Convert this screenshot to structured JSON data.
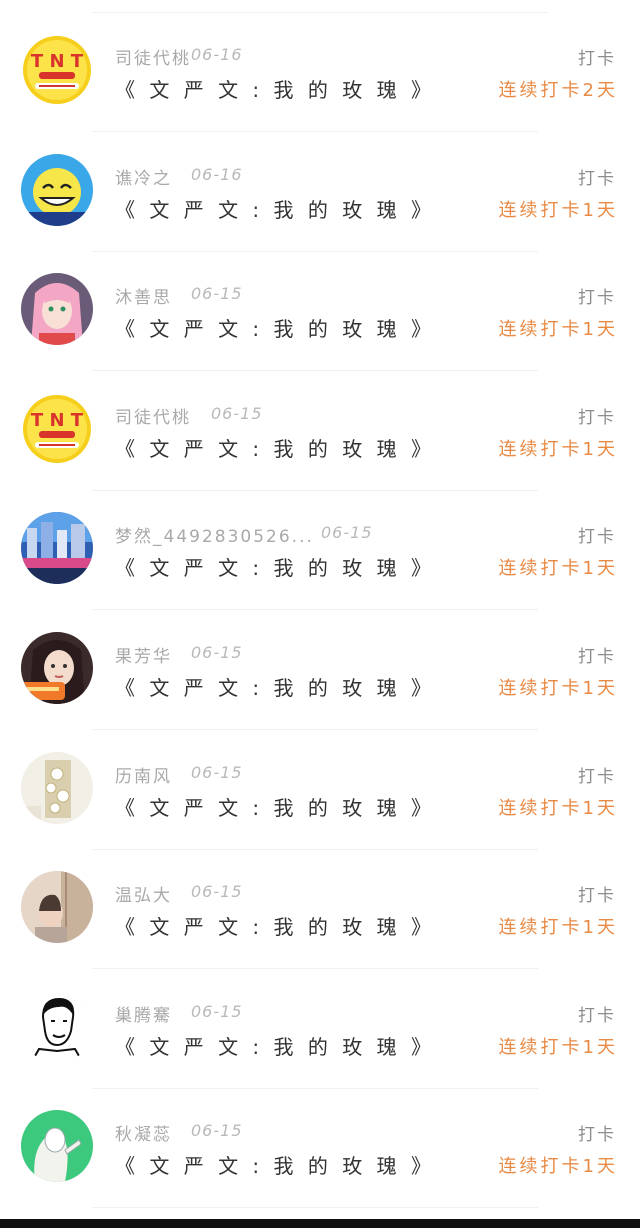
{
  "colors": {
    "name": "#a9a9a9",
    "title": "#333333",
    "action": "#8c8c8c",
    "streak": "#e88a45",
    "divider": "#f0f0f0"
  },
  "records": [
    {
      "name": "司徒代桃",
      "date": "06-16",
      "title": "《 文 严 文 : 我 的 玫 瑰 》",
      "action": "打卡",
      "streak": "连续打卡2天",
      "avatar": "tnt-logo-avatar"
    },
    {
      "name": "谯冷之",
      "date": "06-16",
      "title": "《 文 严 文 : 我 的 玫 瑰 》",
      "action": "打卡",
      "streak": "连续打卡1天",
      "avatar": "yellow-smiley-avatar"
    },
    {
      "name": "沐善思",
      "date": "06-15",
      "title": "《 文 严 文 : 我 的 玫 瑰 》",
      "action": "打卡",
      "streak": "连续打卡1天",
      "avatar": "anime-pink-hair-avatar"
    },
    {
      "name": "司徒代桃",
      "date": "06-15",
      "title": "《 文 严 文 : 我 的 玫 瑰 》",
      "action": "打卡",
      "streak": "连续打卡1天",
      "avatar": "tnt-logo-avatar"
    },
    {
      "name": "梦然_4492830526...",
      "date": "06-15",
      "title": "《 文 严 文 : 我 的 玫 瑰 》",
      "action": "打卡",
      "streak": "连续打卡1天",
      "avatar": "city-skyline-avatar"
    },
    {
      "name": "果芳华",
      "date": "06-15",
      "title": "《 文 严 文 : 我 的 玫 瑰 》",
      "action": "打卡",
      "streak": "连续打卡1天",
      "avatar": "girl-portrait-avatar"
    },
    {
      "name": "历南风",
      "date": "06-15",
      "title": "《 文 严 文 : 我 的 玫 瑰 》",
      "action": "打卡",
      "streak": "连续打卡1天",
      "avatar": "crystal-decor-avatar"
    },
    {
      "name": "温弘大",
      "date": "06-15",
      "title": "《 文 严 文 : 我 的 玫 瑰 》",
      "action": "打卡",
      "streak": "连续打卡1天",
      "avatar": "door-photo-avatar"
    },
    {
      "name": "巢腾騫",
      "date": "06-15",
      "title": "《 文 严 文 : 我 的 玫 瑰 》",
      "action": "打卡",
      "streak": "连续打卡1天",
      "avatar": "man-sketch-avatar"
    },
    {
      "name": "秋凝蕊",
      "date": "06-15",
      "title": "《 文 严 文 : 我 的 玫 瑰 》",
      "action": "打卡",
      "streak": "连续打卡1天",
      "avatar": "green-illustration-avatar"
    }
  ]
}
